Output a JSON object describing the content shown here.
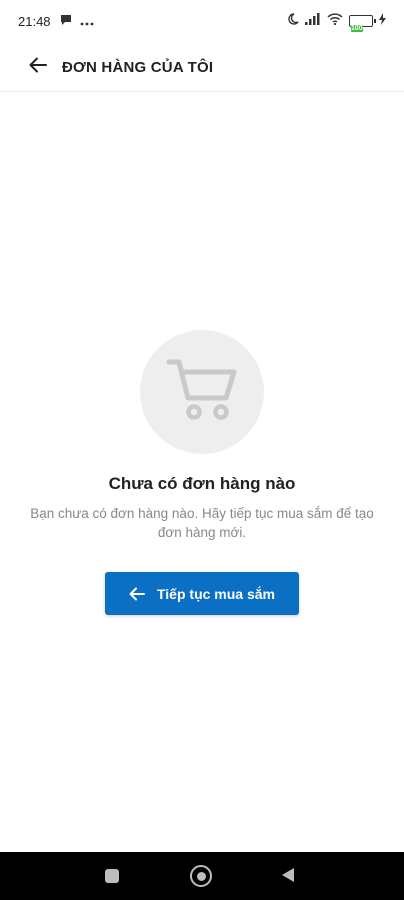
{
  "status_bar": {
    "time": "21:48",
    "battery_label": "100"
  },
  "header": {
    "title": "ĐƠN HÀNG CỦA TÔI"
  },
  "empty_state": {
    "title": "Chưa có đơn hàng nào",
    "description": "Bạn chưa có đơn hàng nào. Hãy tiếp tục mua sắm để tạo đơn hàng mới.",
    "button_label": "Tiếp tục mua sắm"
  },
  "icons": {
    "back": "arrow-left-icon",
    "cart": "shopping-cart-icon",
    "button_arrow": "arrow-left-icon",
    "nav_recent": "square-icon",
    "nav_home": "circle-icon",
    "nav_back": "triangle-back-icon"
  },
  "colors": {
    "accent": "#0b6fc4",
    "cart_bg": "#eeeeee",
    "cart_icon": "#c9c9c9",
    "description_text": "#888888",
    "nav_bar": "#000000"
  }
}
